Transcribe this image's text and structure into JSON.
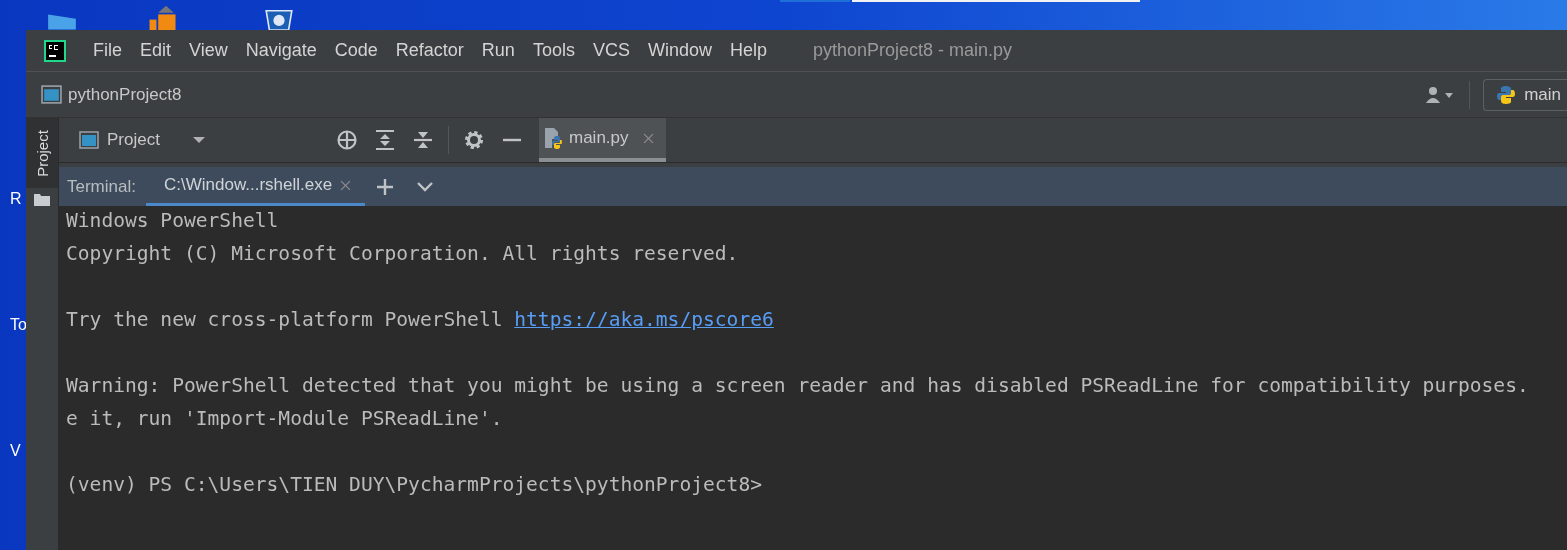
{
  "desktop": {
    "labels": [
      "R",
      "To",
      "V"
    ]
  },
  "window": {
    "title": "pythonProject8 - main.py"
  },
  "menu": [
    "File",
    "Edit",
    "View",
    "Navigate",
    "Code",
    "Refactor",
    "Run",
    "Tools",
    "VCS",
    "Window",
    "Help"
  ],
  "navigation_bar": {
    "project": "pythonProject8",
    "run_config": "main"
  },
  "tool_stripe": {
    "tab": "Project",
    "selected": true
  },
  "project_toolbar": {
    "label": "Project"
  },
  "editor_tabs": [
    {
      "label": "main.py",
      "selected": true
    }
  ],
  "terminal": {
    "label": "Terminal:",
    "tabs": [
      {
        "label": "C:\\Window...rshell.exe",
        "selected": true
      }
    ],
    "lines": [
      {
        "kind": "text",
        "text": "Windows PowerShell"
      },
      {
        "kind": "text",
        "text": "Copyright (C) Microsoft Corporation. All rights reserved."
      },
      {
        "kind": "blank"
      },
      {
        "kind": "link_line",
        "text": "Try the new cross-platform PowerShell ",
        "link": "https://aka.ms/pscore6"
      },
      {
        "kind": "blank"
      },
      {
        "kind": "text",
        "text": "Warning: PowerShell detected that you might be using a screen reader and has disabled PSReadLine for compatibility purposes."
      },
      {
        "kind": "text",
        "text": "e it, run 'Import-Module PSReadLine'."
      },
      {
        "kind": "blank"
      },
      {
        "kind": "text",
        "text": "(venv) PS C:\\Users\\TIEN DUY\\PycharmProjects\\pythonProject8>"
      }
    ]
  }
}
